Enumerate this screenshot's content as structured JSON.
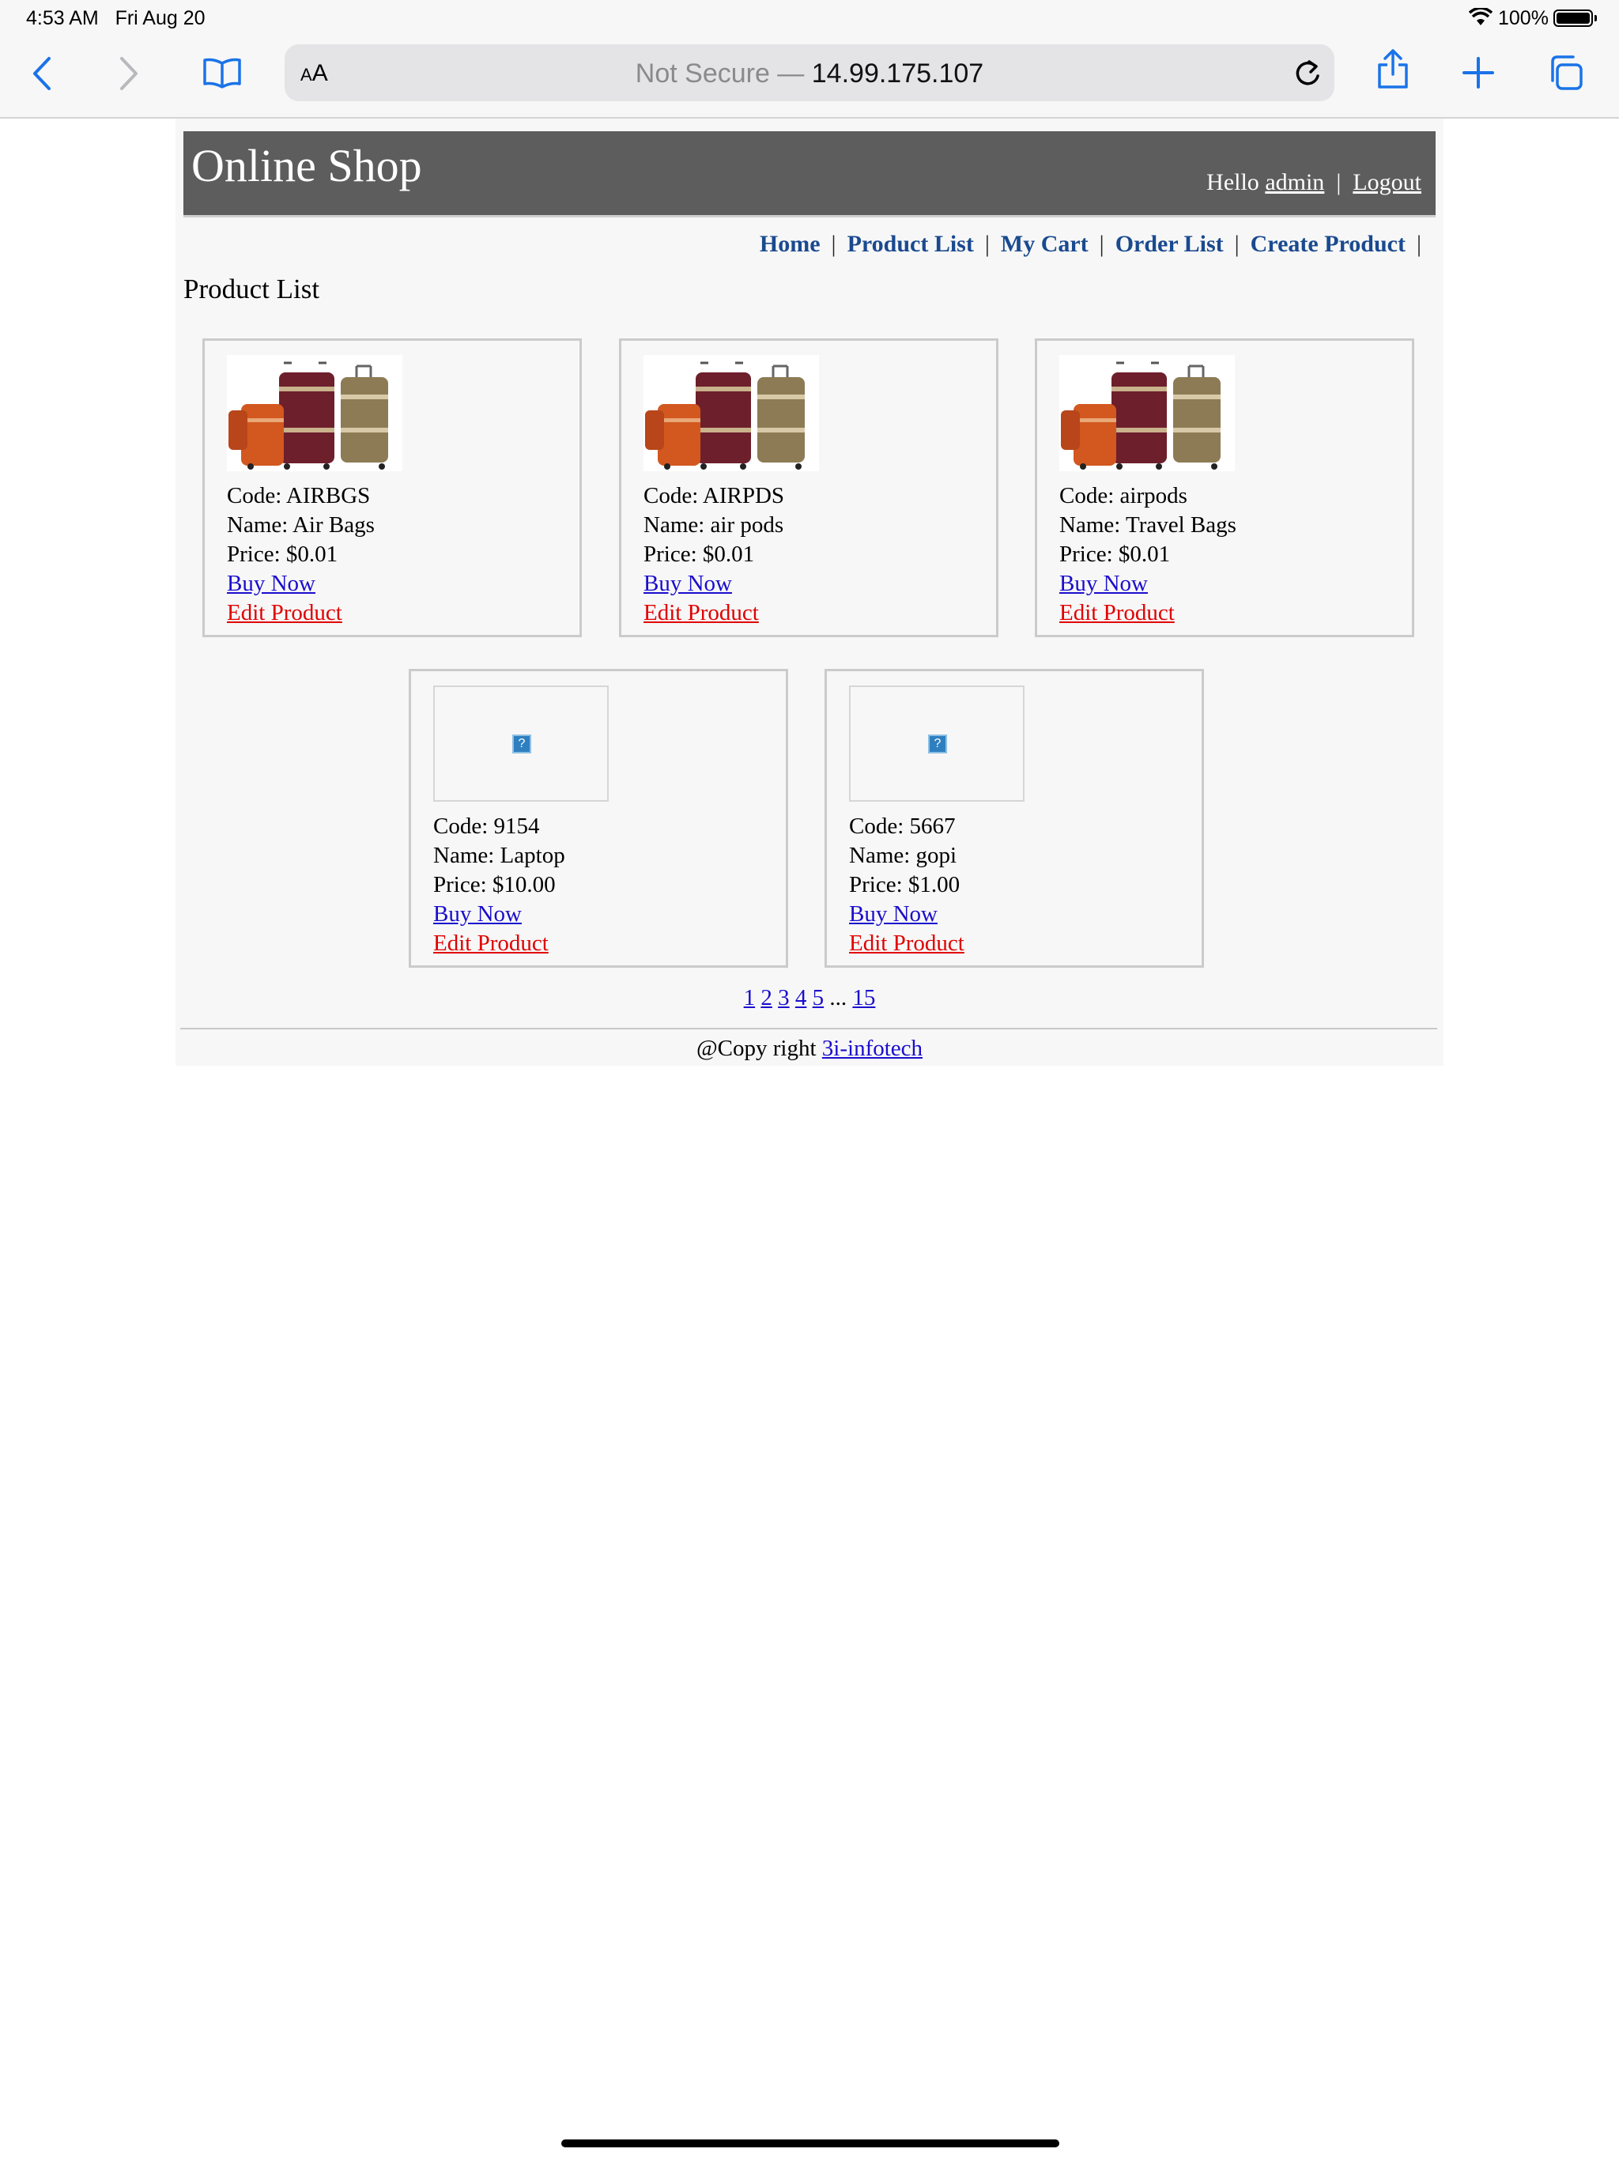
{
  "status_bar": {
    "time": "4:53 AM",
    "date": "Fri Aug 20",
    "battery": "100%"
  },
  "browser": {
    "text_size_label": "AA",
    "url_prefix": "Not Secure — ",
    "url_host": "14.99.175.107",
    "accent_color": "#1a73e8"
  },
  "header": {
    "brand": "Online Shop",
    "hello": "Hello",
    "username": "admin",
    "logout": "Logout",
    "background": "#5d5d5d"
  },
  "menu": {
    "items": [
      "Home",
      "Product List",
      "My Cart",
      "Order List",
      "Create Product"
    ],
    "separator": "|"
  },
  "page_title": "Product List",
  "products": [
    {
      "code_label": "Code: AIRBGS",
      "name_label": "Name: Air Bags",
      "price_label": "Price: $0.01",
      "buy": "Buy Now",
      "edit": "Edit Product",
      "image": "luggage-set"
    },
    {
      "code_label": "Code: AIRPDS",
      "name_label": "Name: air pods",
      "price_label": "Price: $0.01",
      "buy": "Buy Now",
      "edit": "Edit Product",
      "image": "luggage-set"
    },
    {
      "code_label": "Code: airpods",
      "name_label": "Name: Travel Bags",
      "price_label": "Price: $0.01",
      "buy": "Buy Now",
      "edit": "Edit Product",
      "image": "luggage-set"
    },
    {
      "code_label": "Code: 9154",
      "name_label": "Name: Laptop",
      "price_label": "Price: $10.00",
      "buy": "Buy Now",
      "edit": "Edit Product",
      "image": "broken-image-icon"
    },
    {
      "code_label": "Code: 5667",
      "name_label": "Name: gopi",
      "price_label": "Price: $1.00",
      "buy": "Buy Now",
      "edit": "Edit Product",
      "image": "broken-image-icon"
    }
  ],
  "pagination": {
    "pages": [
      "1",
      "2",
      "3",
      "4",
      "5"
    ],
    "ellipsis": "...",
    "last": "15"
  },
  "footer": {
    "text": "@Copy right",
    "link": "3i-infotech"
  },
  "colors": {
    "link": "#1a0dcc",
    "edit_link": "#e00000",
    "menu_link": "#1a4a8f"
  }
}
